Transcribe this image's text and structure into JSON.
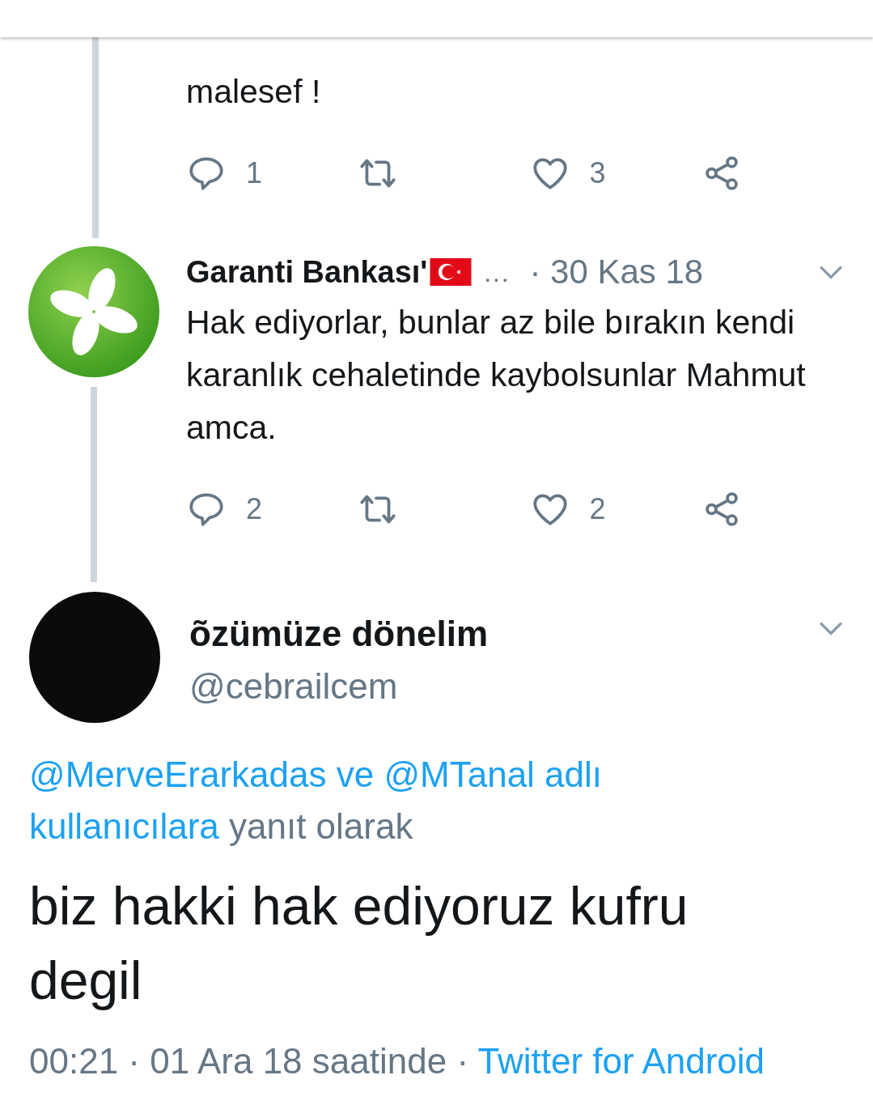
{
  "previous_tweet": {
    "text": "malesef !",
    "actions": {
      "replies": "1",
      "likes": "3"
    }
  },
  "reply_tweet": {
    "name": "Garanti Bankası'",
    "ellipsis": "…",
    "date": "· 30 Kas 18",
    "text": "Hak ediyorlar, bunlar az bile bırakın kendi karanlık cehaletinde kaybolsunlar Mahmut amca.",
    "actions": {
      "replies": "2",
      "likes": "2"
    }
  },
  "main_tweet": {
    "name": "õzümüze dönelim",
    "handle": "@cebrailcem",
    "reply_context": [
      {
        "kind": "mention",
        "text": "@MerveErarkadas"
      },
      {
        "kind": "accent",
        "text": " ve "
      },
      {
        "kind": "mention",
        "text": "@MTanal"
      },
      {
        "kind": "accent",
        "text": " adlı kullanıcılara"
      },
      {
        "kind": "plain",
        "text": " yanıt olarak"
      }
    ],
    "text": "biz hakki hak ediyoruz kufru degil",
    "meta": "00:21 · 01 Ara 18 saatinde · ",
    "source": "Twitter for Android"
  }
}
